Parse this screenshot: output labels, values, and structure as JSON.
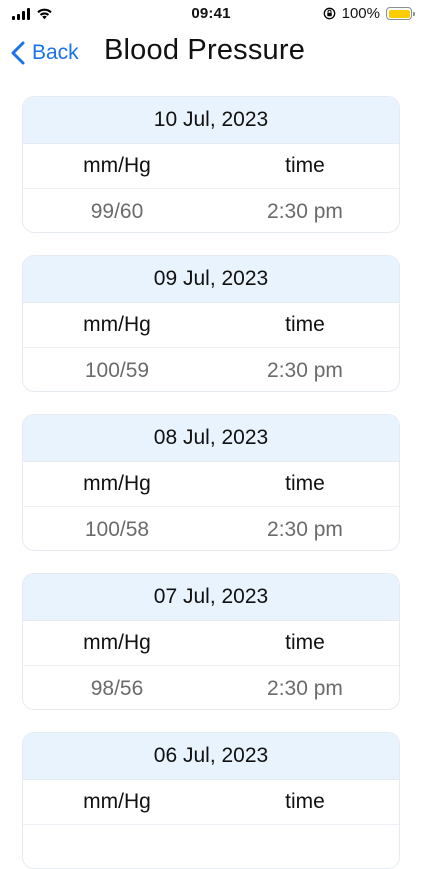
{
  "status_bar": {
    "time": "09:41",
    "battery_text": "100%",
    "icons": [
      "signal-icon",
      "wifi-icon",
      "orientation-lock-icon",
      "battery-icon"
    ]
  },
  "nav": {
    "back_label": "Back",
    "title": "Blood Pressure"
  },
  "colors": {
    "accent": "#1a73e8",
    "card_header": "#e8f3fe",
    "battery": "#ffcc00"
  },
  "records": [
    {
      "date": "10 Jul, 2023",
      "col_pressure": "mm/Hg",
      "col_time": "time",
      "pressure": "99/60",
      "time": "2:30 pm"
    },
    {
      "date": "09 Jul, 2023",
      "col_pressure": "mm/Hg",
      "col_time": "time",
      "pressure": "100/59",
      "time": "2:30 pm"
    },
    {
      "date": "08 Jul, 2023",
      "col_pressure": "mm/Hg",
      "col_time": "time",
      "pressure": "100/58",
      "time": "2:30 pm"
    },
    {
      "date": "07 Jul, 2023",
      "col_pressure": "mm/Hg",
      "col_time": "time",
      "pressure": "98/56",
      "time": "2:30 pm"
    },
    {
      "date": "06 Jul, 2023",
      "col_pressure": "mm/Hg",
      "col_time": "time",
      "pressure": "",
      "time": ""
    }
  ]
}
